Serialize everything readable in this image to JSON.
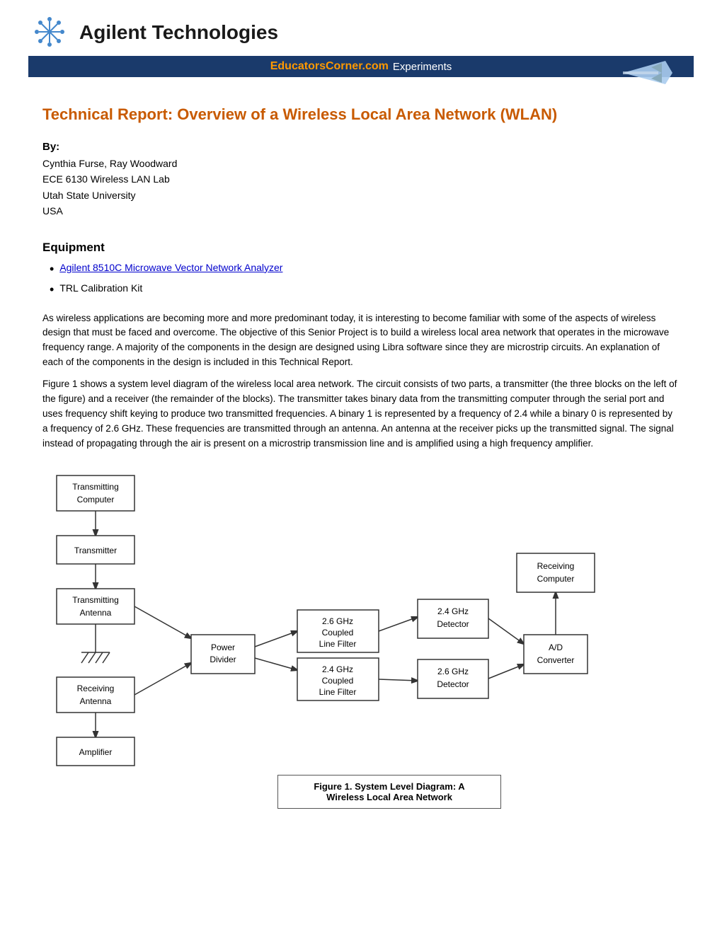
{
  "header": {
    "company": "Agilent Technologies",
    "banner_site": "EducatorsCorner.com",
    "banner_text": "Experiments"
  },
  "page": {
    "title": "Technical Report: Overview of a Wireless Local Area Network (WLAN)",
    "by_label": "By:",
    "author_name": "Cynthia Furse, Ray Woodward",
    "author_course": "ECE 6130 Wireless LAN Lab",
    "author_university": "Utah State University",
    "author_country": "USA"
  },
  "equipment": {
    "title": "Equipment",
    "items": [
      {
        "label": "Agilent 8510C Microwave Vector Network Analyzer",
        "link": true
      },
      {
        "label": "TRL Calibration Kit",
        "link": false
      }
    ]
  },
  "body_paragraphs": [
    "As wireless applications are becoming more and more predominant today, it is interesting to become familiar with some of the aspects of wireless design that must be faced and overcome. The objective of this Senior Project is to build a wireless local area network that operates in the microwave frequency range. A majority of the components in the design are designed using Libra software since they are microstrip circuits. An explanation of each of the components in the design is included in this Technical Report.",
    "Figure 1 shows a system level diagram of the wireless local area network. The circuit consists of two parts, a transmitter (the three blocks on the left of the figure) and a receiver (the remainder of the blocks). The transmitter takes binary data from the transmitting computer through the serial port and uses frequency shift keying to produce two transmitted frequencies. A binary 1 is represented by a frequency of 2.4 while a binary 0 is represented by a frequency of 2.6 GHz. These frequencies are transmitted through an antenna. An antenna at the receiver picks up the transmitted signal. The signal instead of propagating through the air is present on a microstrip transmission line and is amplified using a high frequency amplifier."
  ],
  "diagram": {
    "blocks": {
      "transmitting_computer": "Transmitting\nComputer",
      "transmitter": "Transmitter",
      "transmitting_antenna": "Transmitting\nAntenna",
      "receiving_antenna": "Receiving\nAntenna",
      "amplifier": "Amplifier",
      "power_divider": "Power\nDivider",
      "filter_26": "2.6 GHz\nCoupled\nLine Filter",
      "filter_24": "2.4 GHz\nCoupled\nLine Filter",
      "detector_24": "2.4 GHz\nDetector",
      "detector_26": "2.6 GHz\nDetector",
      "ad_converter": "A/D\nConverter",
      "receiving_computer": "Receiving\nComputer"
    },
    "caption_bold": "Figure 1. System Level Diagram: A",
    "caption_bold2": "Wireless Local Area Network"
  }
}
